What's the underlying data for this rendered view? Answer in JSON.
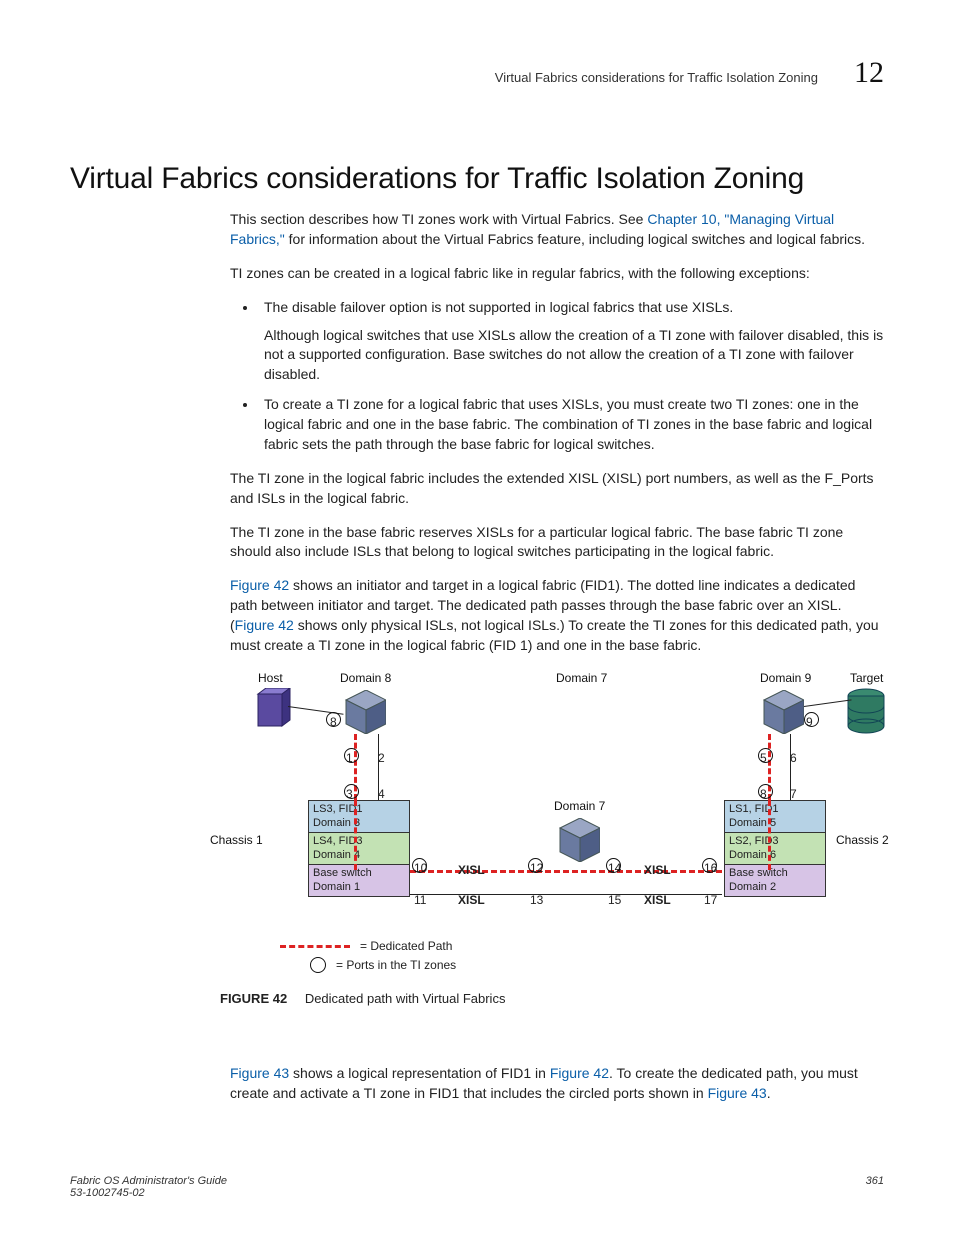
{
  "header": {
    "running_title": "Virtual Fabrics considerations for Traffic Isolation Zoning",
    "chapter_number": "12"
  },
  "title": "Virtual Fabrics considerations for Traffic Isolation Zoning",
  "intro": {
    "p1_a": "This section describes how TI zones work with Virtual Fabrics. See ",
    "p1_link": "Chapter 10, \"Managing Virtual Fabrics,\"",
    "p1_b": " for information about the Virtual Fabrics feature, including logical switches and logical fabrics.",
    "p2": "TI zones can be created in a logical fabric like in regular fabrics, with the following exceptions:"
  },
  "bullets": [
    {
      "lead": "The disable failover option is not supported in logical fabrics that use XISLs.",
      "detail": "Although logical switches that use XISLs allow the creation of a TI zone with failover disabled, this is not a supported configuration. Base switches do not allow the creation of a TI zone with failover disabled."
    },
    {
      "lead": "To create a TI zone for a logical fabric that uses XISLs, you must create two TI zones: one in the logical fabric and one in the base fabric. The combination of TI zones in the base fabric and logical fabric sets the path through the base fabric for logical switches."
    }
  ],
  "after": {
    "p3": "The TI zone in the logical fabric includes the extended XISL (XISL) port numbers, as well as the F_Ports and ISLs in the logical fabric.",
    "p4": "The TI zone in the base fabric reserves XISLs for a particular logical fabric. The base fabric TI zone should also include ISLs that belong to logical switches participating in the logical fabric.",
    "p5_a": "Figure 42",
    "p5_b": " shows an initiator and target in a logical fabric (FID1). The dotted line indicates a dedicated path between initiator and target. The dedicated path passes through the base fabric over an XISL. (",
    "p5_c": "Figure 42",
    "p5_d": " shows only physical ISLs, not logical ISLs.) To create the TI zones for this dedicated path, you must create a TI zone in the logical fabric (FID 1) and one in the base fabric."
  },
  "figure": {
    "labels": {
      "host": "Host",
      "domain8": "Domain 8",
      "domain9": "Domain 9",
      "target": "Target",
      "domain7": "Domain 7",
      "chassis1": "Chassis 1",
      "chassis2": "Chassis 2"
    },
    "stack_left": {
      "r1a": "LS3, FID1",
      "r1b": "Domain 3",
      "r2a": "LS4, FID3",
      "r2b": "Domain 4",
      "r3a": "Base switch",
      "r3b": "Domain 1"
    },
    "stack_right": {
      "r1a": "LS1, FID1",
      "r1b": "Domain 5",
      "r2a": "LS2, FID3",
      "r2b": "Domain 6",
      "r3a": "Base switch",
      "r3b": "Domain 2"
    },
    "ports": {
      "p8": "8",
      "p1": "1",
      "p2": "2",
      "p3": "3",
      "p4": "4",
      "p10": "10",
      "p11": "11",
      "p12": "12",
      "p13": "13",
      "p14": "14",
      "p15": "15",
      "p16": "16",
      "p17": "17",
      "p9": "9",
      "p5": "5",
      "p6": "6",
      "p7r": "7",
      "p8r": "8"
    },
    "xisl": "XISL",
    "legend1": "= Dedicated Path",
    "legend2": "= Ports in the TI zones",
    "caption_label": "FIGURE 42",
    "caption_text": "Dedicated path with Virtual Fabrics"
  },
  "closing": {
    "a": "Figure 43",
    "b": " shows a logical representation of FID1 in ",
    "c": "Figure 42",
    "d": ". To create the dedicated path, you must create and activate a TI zone in FID1 that includes the circled ports shown in ",
    "e": "Figure 43",
    "f": "."
  },
  "footer": {
    "book": "Fabric OS Administrator's Guide",
    "docnum": "53-1002745-02",
    "page": "361"
  }
}
